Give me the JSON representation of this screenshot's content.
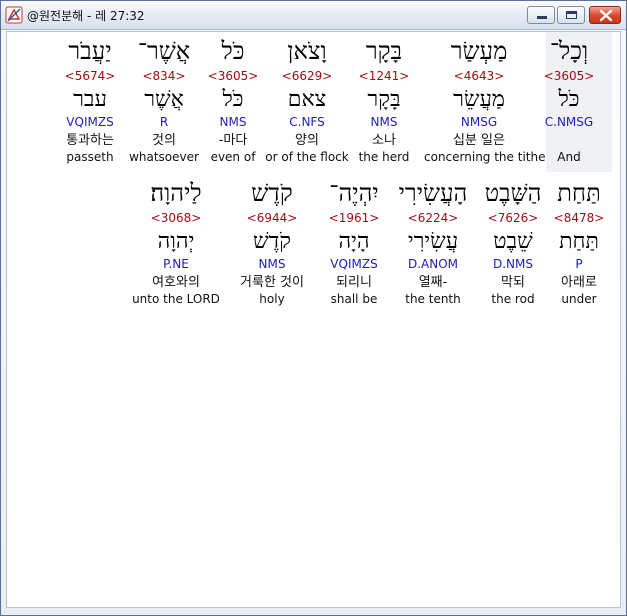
{
  "window": {
    "title": "@원전분해 - 레 27:32"
  },
  "rows": [
    {
      "words": [
        {
          "hebrew": "יַעֲבֹר",
          "strong": "<5674>",
          "root": "עבר",
          "parse": "VQIMZS",
          "korean": "통과하는",
          "english": "passeth"
        },
        {
          "hebrew": "אֲשֶׁר־",
          "strong": "<834>",
          "root": "אֲשֶׁר",
          "parse": "R",
          "korean": "것의",
          "english": "whatsoever"
        },
        {
          "hebrew": "כֹּל",
          "strong": "<3605>",
          "root": "כֹּל",
          "parse": "NMS",
          "korean": "-마다",
          "english": "even of"
        },
        {
          "hebrew": "וָצֹאן",
          "strong": "<6629>",
          "root": "צאם",
          "parse": "C.NFS",
          "korean": "양의",
          "english": "or of the flock"
        },
        {
          "hebrew": "בָּקָר",
          "strong": "<1241>",
          "root": "בָּקָר",
          "parse": "NMS",
          "korean": "소나",
          "english": "the herd"
        },
        {
          "hebrew": "מַעְשַׂר",
          "strong": "<4643>",
          "root": "מַעֲשֵׂר",
          "parse": "NMSG",
          "korean": "십분 일은",
          "english": "concerning the tithe"
        },
        {
          "hebrew": "וְכָל־",
          "strong": "<3605>",
          "root": "כֹּל",
          "parse": "C.NMSG",
          "korean": "",
          "english": "And"
        }
      ]
    },
    {
      "words": [
        {
          "hebrew": "לַיהוָה׃",
          "strong": "<3068>",
          "root": "יְהוָה",
          "parse": "P.NE",
          "korean": "여호와의",
          "english": "unto the LORD"
        },
        {
          "hebrew": "קֹדֶשׁ",
          "strong": "<6944>",
          "root": "קֹדֶשׁ",
          "parse": "NMS",
          "korean": "거룩한 것이",
          "english": "holy"
        },
        {
          "hebrew": "יִהְיֶה־",
          "strong": "<1961>",
          "root": "הָיָה",
          "parse": "VQIMZS",
          "korean": "되리니",
          "english": "shall be"
        },
        {
          "hebrew": "הָעֲשִׂירִי",
          "strong": "<6224>",
          "root": "עֲשִׂירִי",
          "parse": "D.ANOM",
          "korean": "열째-",
          "english": "the tenth"
        },
        {
          "hebrew": "הַשָּׁבֶט",
          "strong": "<7626>",
          "root": "שֵׁבֶט",
          "parse": "D.NMS",
          "korean": "막되",
          "english": "the rod"
        },
        {
          "hebrew": "תַּחַת",
          "strong": "<8478>",
          "root": "תַּחַת",
          "parse": "P",
          "korean": "아래로",
          "english": "under"
        }
      ]
    }
  ]
}
